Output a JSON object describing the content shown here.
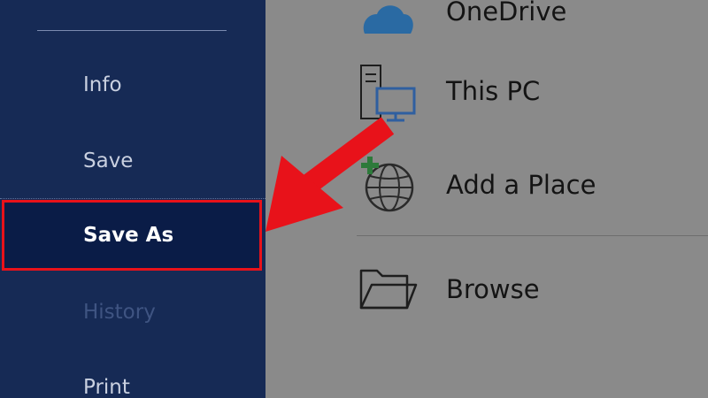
{
  "sidebar": {
    "items": [
      {
        "label": "Info"
      },
      {
        "label": "Save"
      },
      {
        "label": "Save As"
      },
      {
        "label": "History"
      },
      {
        "label": "Print"
      }
    ],
    "selected": "Save As"
  },
  "places": [
    {
      "label": "OneDrive",
      "icon": "cloud-icon"
    },
    {
      "label": "This PC",
      "icon": "computer-icon"
    },
    {
      "label": "Add a Place",
      "icon": "add-globe-icon"
    },
    {
      "label": "Browse",
      "icon": "folder-icon"
    }
  ],
  "annotation": {
    "color": "#e8121a",
    "type": "arrow pointing to Save As"
  },
  "colors": {
    "sidebar_bg": "#162a55",
    "selected_bg": "#0a1c47",
    "content_bg": "#8a8a8a",
    "highlight": "#e8121a"
  }
}
